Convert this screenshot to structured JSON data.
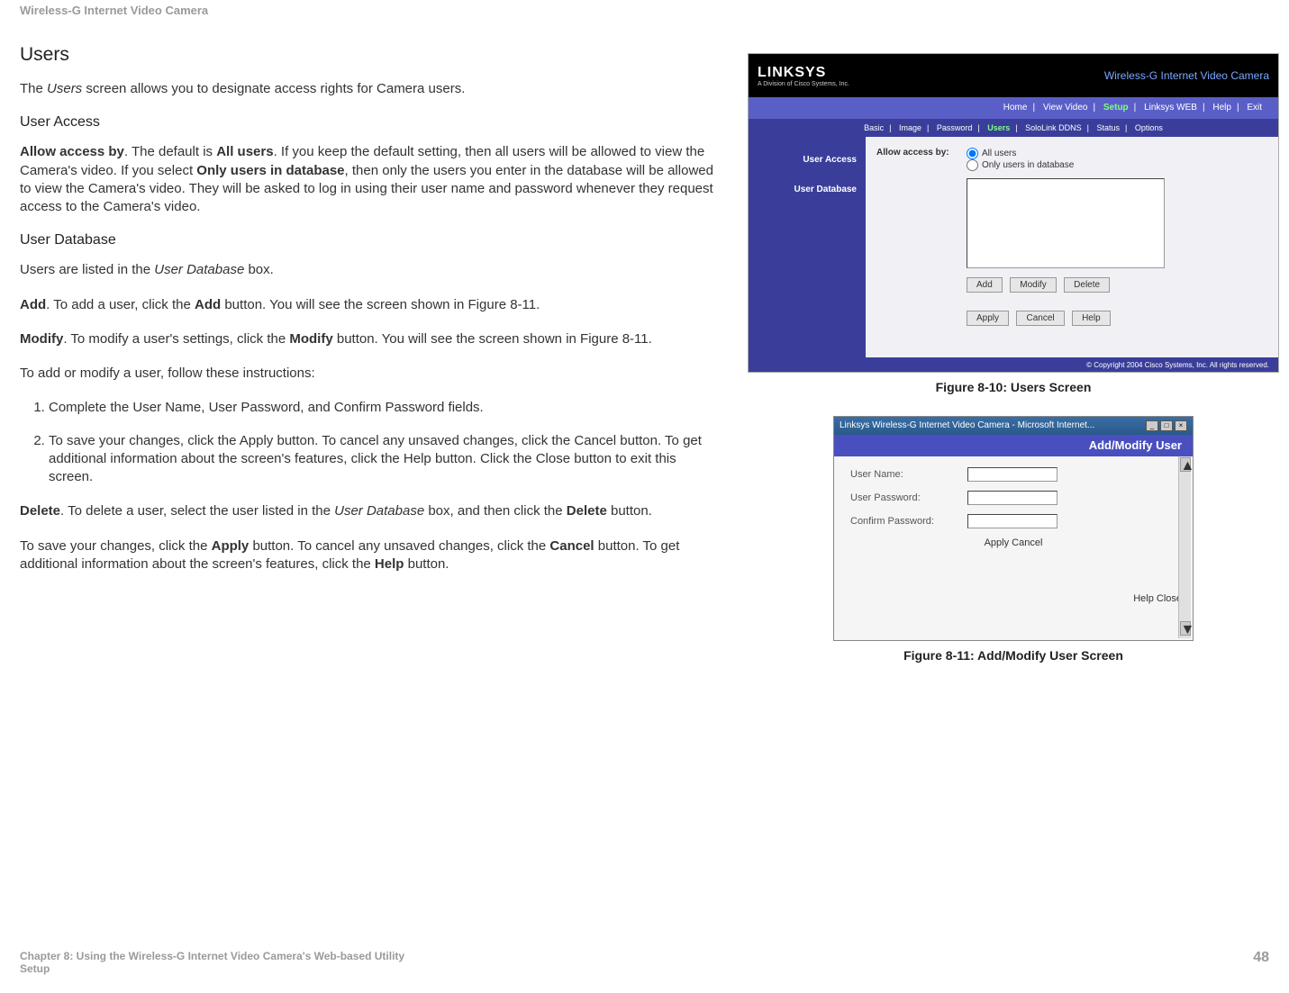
{
  "page": {
    "header": "Wireless-G Internet Video Camera",
    "footer_left_line1": "Chapter 8: Using the Wireless-G Internet Video Camera's Web-based Utility",
    "footer_left_line2": "Setup",
    "footer_page": "48"
  },
  "sections": {
    "users_title": "Users",
    "users_intro_1": "The ",
    "users_intro_italic": "Users",
    "users_intro_2": " screen allows you to designate access rights for Camera users.",
    "user_access_title": "User Access",
    "ua_b1": "Allow access by",
    "ua_t1": ". The default is ",
    "ua_b2": "All users",
    "ua_t2": ". If you keep the default setting, then all users will be allowed to view the Camera's video. If you select ",
    "ua_b3": "Only users in database",
    "ua_t3": ", then only the users you enter in the database will be allowed to view the Camera's video. They will be asked to log in using their user name and password whenever they request access to the Camera's video.",
    "user_db_title": "User Database",
    "udb_t1": "Users are listed in the ",
    "udb_i1": "User Database",
    "udb_t2": " box.",
    "add_b": "Add",
    "add_t1": ". To add a user, click the ",
    "add_b2": "Add",
    "add_t2": " button. You will see the screen shown in Figure 8-11.",
    "mod_b": "Modify",
    "mod_t1": ". To modify a user's settings, click the ",
    "mod_b2": "Modify",
    "mod_t2": " button. You will see the screen shown in Figure 8-11.",
    "steps_intro": "To add or modify a user, follow these instructions:",
    "step1_t1": "Complete the ",
    "step1_i1": "User Name",
    "step1_t2": ", ",
    "step1_i2": "User Password",
    "step1_t3": ", and ",
    "step1_i3": "Confirm Password",
    "step1_t4": " fields.",
    "step2_t1": "To save your changes, click the ",
    "step2_b1": "Apply",
    "step2_t2": " button. To cancel any unsaved changes, click the ",
    "step2_b2": "Cancel",
    "step2_t3": " button. To get additional information about the screen's features, click the ",
    "step2_b3": "Help",
    "step2_t4": " button. Click the ",
    "step2_b4": "Close",
    "step2_t5": " button to exit this screen.",
    "del_b": "Delete",
    "del_t1": ". To delete a user, select the user listed in the ",
    "del_i1": "User Database",
    "del_t2": " box, and then click the ",
    "del_b2": "Delete",
    "del_t3": " button.",
    "save_t1": "To save your changes, click the ",
    "save_b1": "Apply",
    "save_t2": " button. To cancel any unsaved changes, click the ",
    "save_b2": "Cancel",
    "save_t3": " button. To get additional information about the screen's features, click the ",
    "save_b3": "Help",
    "save_t4": " button."
  },
  "fig1": {
    "caption": "Figure 8-10: Users Screen",
    "logo": "LINKSYS",
    "logo_sub": "A Division of Cisco Systems, Inc.",
    "product": "Wireless-G Internet Video Camera",
    "nav1": {
      "home": "Home",
      "view": "View Video",
      "setup": "Setup",
      "lweb": "Linksys WEB",
      "help": "Help",
      "exit": "Exit"
    },
    "nav2": {
      "basic": "Basic",
      "image": "Image",
      "password": "Password",
      "users": "Users",
      "ddns": "SoloLink DDNS",
      "status": "Status",
      "options": "Options"
    },
    "sidebar": {
      "ua": "User Access",
      "udb": "User Database"
    },
    "panel": {
      "label": "Allow access by:",
      "r1": "All users",
      "r2": "Only users in database",
      "btn_add": "Add",
      "btn_modify": "Modify",
      "btn_delete": "Delete",
      "btn_apply": "Apply",
      "btn_cancel": "Cancel",
      "btn_help": "Help"
    },
    "copyright": "© Copyright 2004 Cisco Systems, Inc. All rights reserved."
  },
  "fig2": {
    "caption": "Figure 8-11: Add/Modify User Screen",
    "window_title": "Linksys Wireless-G Internet Video Camera - Microsoft Internet...",
    "heading": "Add/Modify User",
    "f_user": "User Name:",
    "f_pass": "User Password:",
    "f_conf": "Confirm Password:",
    "btn_apply": "Apply",
    "btn_cancel": "Cancel",
    "btn_help": "Help",
    "btn_close": "Close"
  }
}
